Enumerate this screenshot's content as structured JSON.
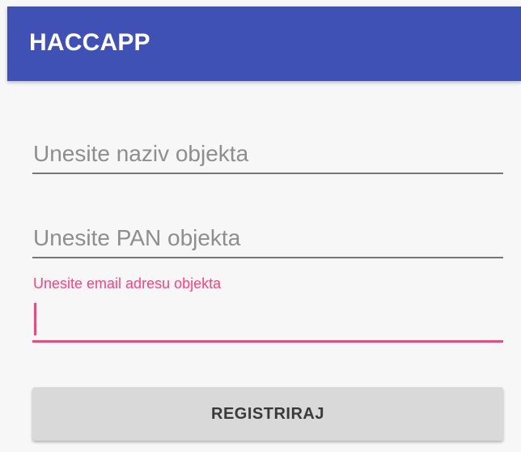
{
  "app_bar": {
    "title": "HACCAPP",
    "color": "#3f51b5"
  },
  "form": {
    "name_field": {
      "placeholder": "Unesite naziv objekta",
      "value": ""
    },
    "pan_field": {
      "placeholder": "Unesite PAN objekta",
      "value": ""
    },
    "email_field": {
      "label": "Unesite email adresu objekta",
      "value": "",
      "focused": true,
      "accent_color": "#ff4081"
    },
    "submit_label": "REGISTRIRAJ"
  }
}
